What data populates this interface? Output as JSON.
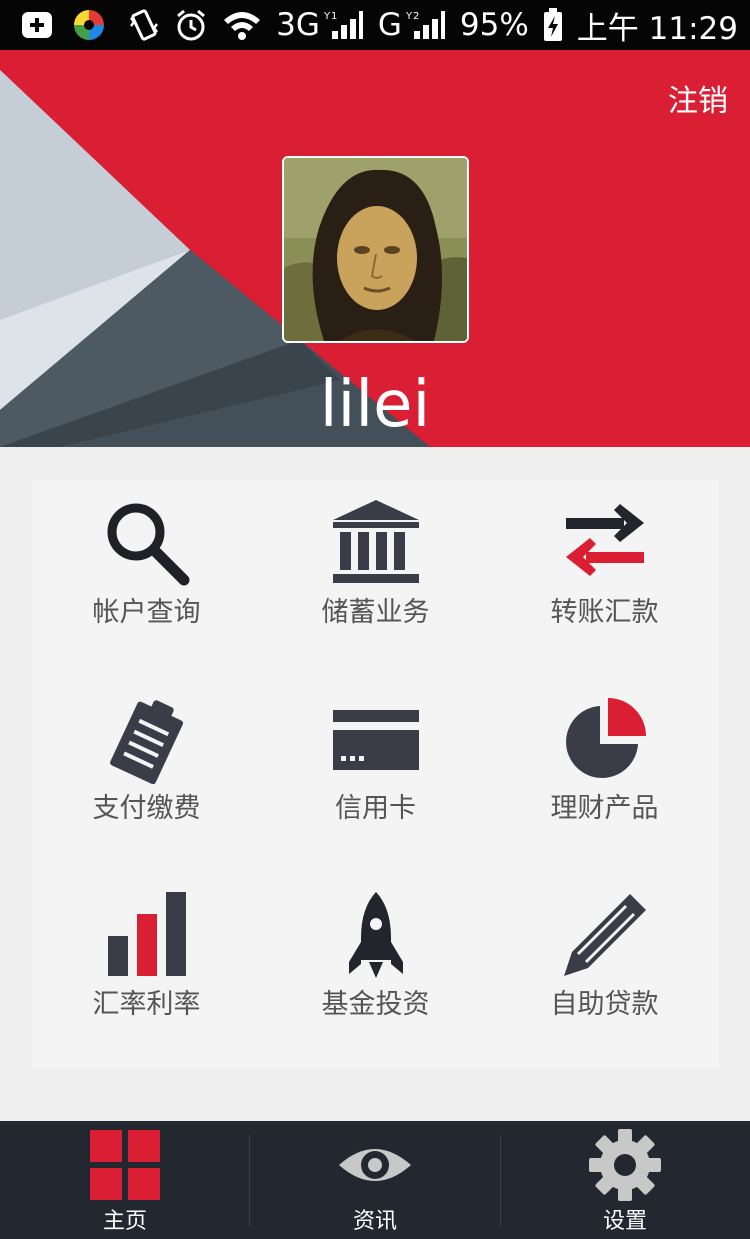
{
  "status_bar": {
    "network_1": "3G",
    "sim_1": "1",
    "network_2": "G",
    "sim_2": "2",
    "battery": "95%",
    "time": "上午 11:29"
  },
  "header": {
    "logout_label": "注销",
    "username": "lilei"
  },
  "menu": {
    "items": [
      {
        "label": "帐户查询",
        "icon": "search-icon"
      },
      {
        "label": "储蓄业务",
        "icon": "bank-icon"
      },
      {
        "label": "转账汇款",
        "icon": "transfer-arrows-icon"
      },
      {
        "label": "支付缴费",
        "icon": "bill-icon"
      },
      {
        "label": "信用卡",
        "icon": "credit-card-icon"
      },
      {
        "label": "理财产品",
        "icon": "pie-chart-icon"
      },
      {
        "label": "汇率利率",
        "icon": "bar-chart-icon"
      },
      {
        "label": "基金投资",
        "icon": "rocket-icon"
      },
      {
        "label": "自助贷款",
        "icon": "pencil-icon"
      }
    ]
  },
  "bottom_nav": {
    "tabs": [
      {
        "label": "主页",
        "icon": "grid-icon",
        "active": true
      },
      {
        "label": "资讯",
        "icon": "eye-icon",
        "active": false
      },
      {
        "label": "设置",
        "icon": "gear-icon",
        "active": false
      }
    ]
  },
  "colors": {
    "accent_red": "#da1e34",
    "icon_dark": "#3a3d47",
    "nav_bg": "#232730"
  }
}
